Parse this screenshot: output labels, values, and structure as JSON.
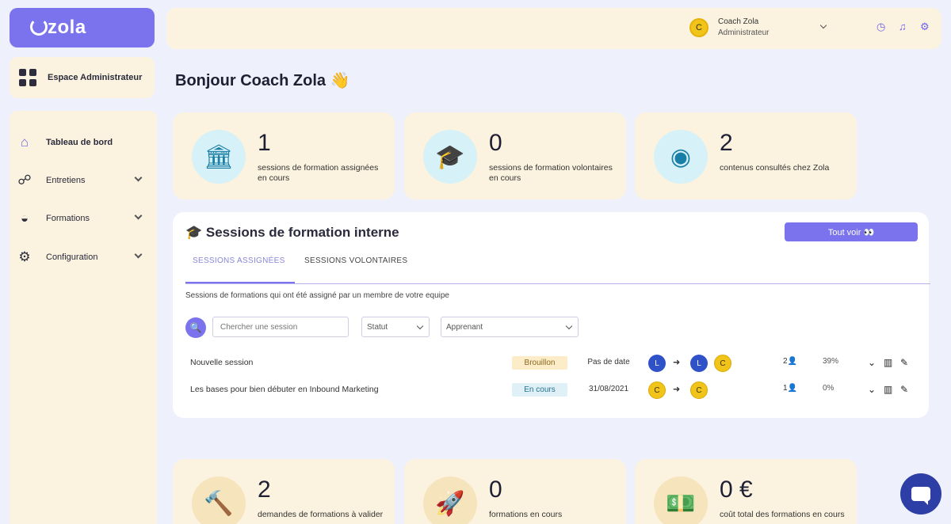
{
  "brand": {
    "name": "zola"
  },
  "sidebar": {
    "space_label": "Espace Administrateur",
    "items": [
      {
        "label": "Tableau de bord",
        "icon": "home-icon",
        "active": true,
        "has_children": false
      },
      {
        "label": "Entretiens",
        "icon": "chat-icon",
        "active": false,
        "has_children": true
      },
      {
        "label": "Formations",
        "icon": "graduation-icon",
        "active": false,
        "has_children": true
      },
      {
        "label": "Configuration",
        "icon": "gear-icon",
        "active": false,
        "has_children": true
      }
    ]
  },
  "topbar": {
    "user_initial": "C",
    "user_name": "Coach Zola",
    "user_role": "Administrateur",
    "icons": [
      "clock-icon",
      "bell-icon",
      "gear-icon"
    ]
  },
  "greeting": "Bonjour Coach Zola 👋",
  "stats_top": [
    {
      "value": "1",
      "label": "sessions de formation assignées en cours",
      "icon": "bank-icon"
    },
    {
      "value": "0",
      "label": "sessions de formation volontaires en cours",
      "icon": "graduation-cap-icon"
    },
    {
      "value": "2",
      "label": "contenus consultés chez Zola",
      "icon": "eye-icon"
    }
  ],
  "sessions": {
    "title": "🎓 Sessions de formation interne",
    "see_all": "Tout voir 👀",
    "tabs": [
      {
        "label": "SESSIONS ASSIGNÉES",
        "active": true
      },
      {
        "label": "SESSIONS VOLONTAIRES",
        "active": false
      }
    ],
    "hint": "Sessions de formations qui ont été assigné par un membre de votre equipe",
    "search_placeholder": "Chercher une session",
    "status_filter": "Statut",
    "learner_filter": "Apprenant",
    "rows": [
      {
        "name": "Nouvelle session",
        "status": "Brouillon",
        "status_kind": "draft",
        "date": "Pas de date",
        "from": [
          "L"
        ],
        "to": [
          "L",
          "C"
        ],
        "count": "2",
        "progress": "39%"
      },
      {
        "name": "Les bases pour bien débuter en Inbound Marketing",
        "status": "En cours",
        "status_kind": "progress",
        "date": "31/08/2021",
        "from": [
          "C"
        ],
        "to": [
          "C"
        ],
        "count": "1",
        "progress": "0%"
      }
    ]
  },
  "stats_bottom": [
    {
      "value": "2",
      "label": "demandes de formations à valider",
      "icon": "gavel-icon"
    },
    {
      "value": "0",
      "label": "formations en cours",
      "icon": "rocket-icon"
    },
    {
      "value": "0 €",
      "label": "coût total des formations en cours",
      "icon": "banknote-icon"
    }
  ],
  "colors": {
    "accent": "#7b72ee",
    "cream": "#fbf3df",
    "background": "#eef0fb",
    "badge_draft": "#fdecc8",
    "badge_progress": "#dff1f7"
  }
}
